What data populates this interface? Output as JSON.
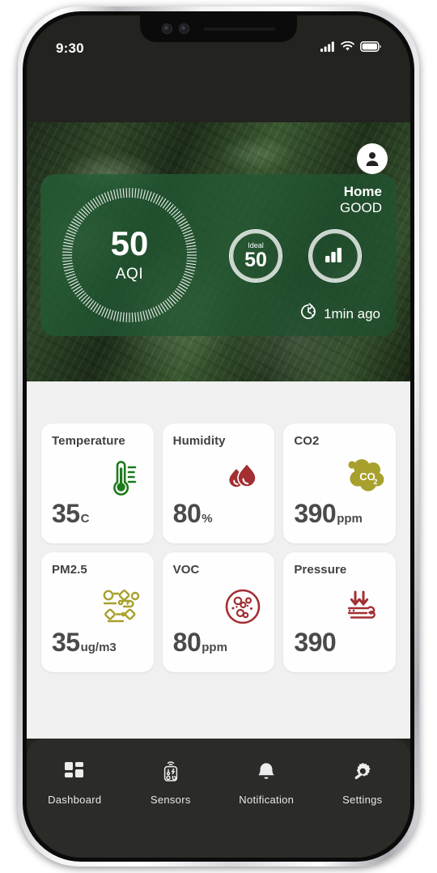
{
  "status_bar": {
    "time": "9:30",
    "icons": [
      "signal-icon",
      "wifi-icon",
      "battery-icon"
    ]
  },
  "hero": {
    "avatar_icon": "user-avatar-icon",
    "place_name": "Home",
    "quality_label": "GOOD",
    "gauge": {
      "value": "50",
      "label": "AQI"
    },
    "ideal": {
      "caption": "Ideal",
      "value": "50"
    },
    "chart_button_icon": "bar-chart-icon",
    "updated": {
      "icon": "clock-refresh-icon",
      "text": "1min ago"
    }
  },
  "metrics": [
    {
      "title": "Temperature",
      "value": "35",
      "unit": "C",
      "icon": "thermometer-icon",
      "color": "#1d7a1d"
    },
    {
      "title": "Humidity",
      "value": "80",
      "unit": "%",
      "icon": "water-droplets-icon",
      "color": "#a32f32"
    },
    {
      "title": "CO2",
      "value": "390",
      "unit": "ppm",
      "icon": "co2-cloud-icon",
      "color": "#a8a02c"
    },
    {
      "title": "PM2.5",
      "value": "35",
      "unit": "ug/m3",
      "icon": "particles-icon",
      "color": "#a8a02c"
    },
    {
      "title": "VOC",
      "value": "80",
      "unit": "ppm",
      "icon": "germ-icon",
      "color": "#a32f32"
    },
    {
      "title": "Pressure",
      "value": "390",
      "unit": "",
      "icon": "pressure-wind-icon",
      "color": "#a32f32"
    }
  ],
  "bottom_nav": {
    "items": [
      {
        "label": "Dashboard",
        "icon": "grid-dashboard-icon"
      },
      {
        "label": "Sensors",
        "icon": "sensor-device-icon"
      },
      {
        "label": "Notification",
        "icon": "bell-icon"
      },
      {
        "label": "Settings",
        "icon": "gear-wrench-icon"
      }
    ]
  },
  "theme": {
    "accent_green": "#2d5e36",
    "card_bg": "#fefefe",
    "content_bg": "#f0f0f0",
    "nav_bg": "#2b2b28"
  }
}
